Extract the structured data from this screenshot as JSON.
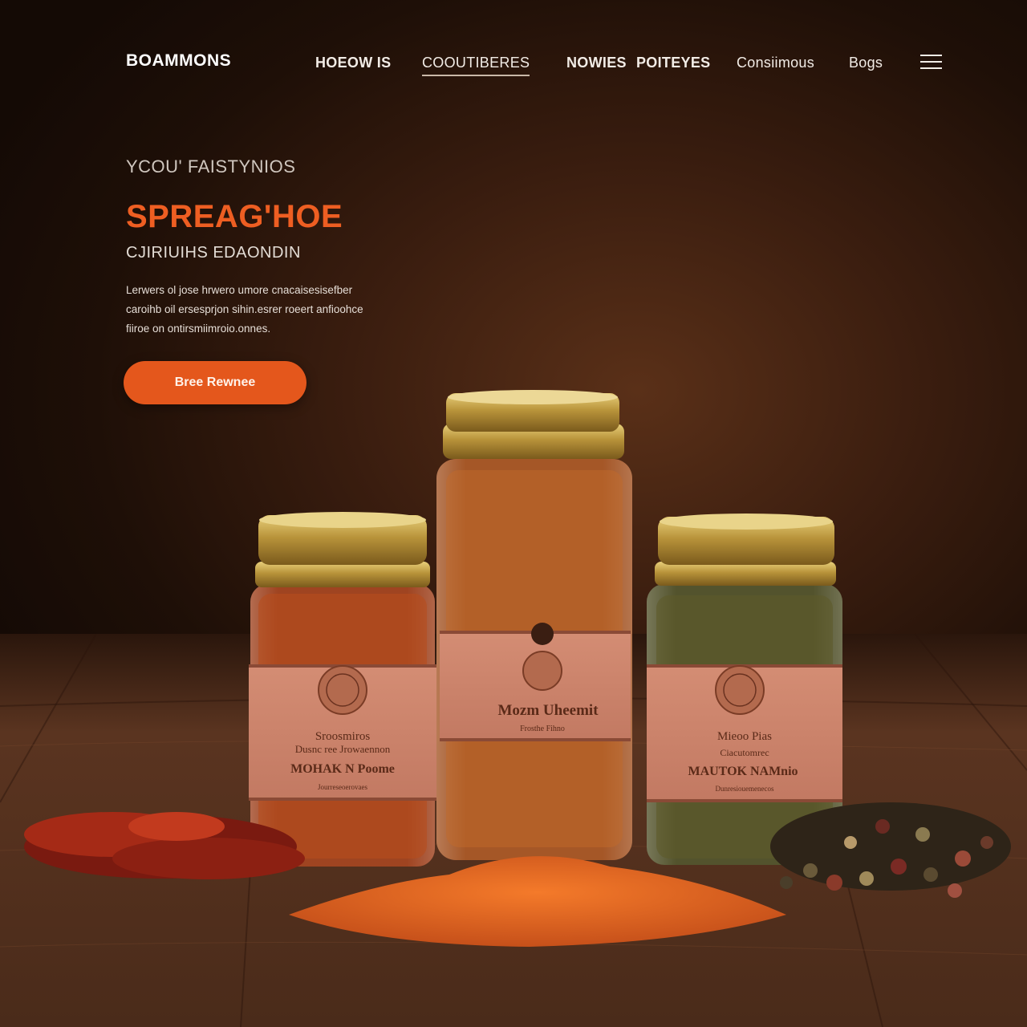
{
  "nav": {
    "brand": "BOAMMONS",
    "items": [
      {
        "label": "HOEOW IS",
        "bold": true
      },
      {
        "label": "COOUTIBERES",
        "bold": false,
        "active": true
      },
      {
        "label": "NOWIES",
        "bold": true
      },
      {
        "label": "POITEYES",
        "bold": true
      },
      {
        "label": "Consiimous",
        "bold": false
      },
      {
        "label": "Bogs",
        "bold": false
      }
    ],
    "menu_icon": "hamburger-menu-icon"
  },
  "hero": {
    "eyebrow": "YCOU' FAISTYNIOS",
    "headline": "SPREAG'HOE",
    "subhead": "CJIRIUIHS EDAONDIN",
    "description": [
      "Lerwers ol jose hrwero umore cnacaisesisefber",
      "caroihb oil ersesprjon sihin.esrer roeert anfioohce",
      "fiiroe on ontirsmiimroio.onnes."
    ],
    "cta_label": "Bree Rewnee",
    "accent_color": "#e4571c"
  },
  "products": [
    {
      "label_top": "Sroosmiros",
      "label_mid": "Dusnc ree Jrowaennon",
      "label_main": "MOHAK N Poome",
      "label_bottom": "Jourreseoerovaes"
    },
    {
      "label_top": "",
      "label_mid": "",
      "label_main": "Mozm Uheemit",
      "label_bottom": "Frosthe Fihno"
    },
    {
      "label_top": "Mieoo Pias",
      "label_mid": "Ciacutomrec",
      "label_main": "MAUTOK NAMnio",
      "label_bottom": "Dunresiouemenecos"
    }
  ]
}
